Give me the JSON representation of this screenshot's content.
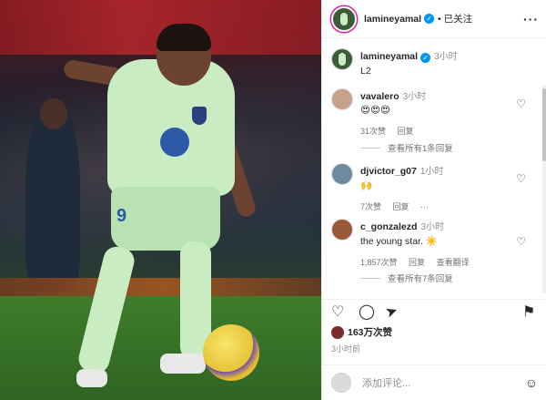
{
  "post_author": {
    "username": "lamineyamal",
    "follow_label": "已关注",
    "more_icon": "more-horizontal-icon"
  },
  "caption": {
    "username": "lamineyamal",
    "time": "3小时",
    "text": "L2"
  },
  "comments": [
    {
      "username": "vavalero",
      "time": "3小时",
      "text": "😍😍😍",
      "likes": "31次赞",
      "reply": "回复",
      "translate": "",
      "view_replies": "查看所有1条回复"
    },
    {
      "username": "djvictor_g07",
      "time": "1小时",
      "text": "🙌",
      "likes": "7次赞",
      "reply": "回复",
      "translate": "",
      "view_replies": ""
    },
    {
      "username": "c_gonzalezd",
      "time": "3小时",
      "text": "the young star. ☀️",
      "likes": "1,857次赞",
      "reply": "回复",
      "translate": "查看翻译",
      "view_replies": "查看所有7条回复"
    }
  ],
  "footer": {
    "likes_count": "163万次赞",
    "post_time": "3小时前",
    "add_comment_placeholder": "添加评论..."
  },
  "photo": {
    "shorts_number": "9"
  },
  "colors": {
    "verified": "#0095f6",
    "link_text": "#737373",
    "story_ring": "#d6249f"
  }
}
